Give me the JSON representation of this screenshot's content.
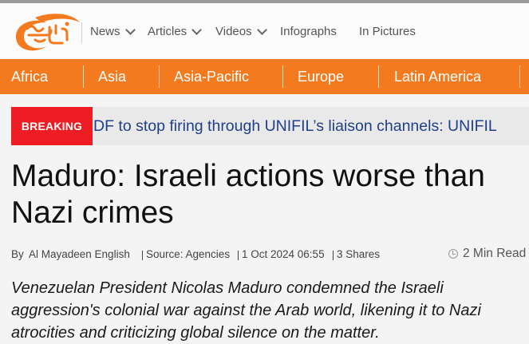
{
  "header": {
    "logo_name": "al-mayadeen-logo",
    "nav": [
      {
        "label": "News",
        "has_dropdown": true
      },
      {
        "label": "Articles",
        "has_dropdown": true
      },
      {
        "label": "Videos",
        "has_dropdown": true
      },
      {
        "label": "Infographs",
        "has_dropdown": false
      },
      {
        "label": "In Pictures",
        "has_dropdown": false
      }
    ]
  },
  "regions": [
    "Africa",
    "Asia",
    "Asia-Pacific",
    "Europe",
    "Latin America"
  ],
  "breaking": {
    "tag": "BREAKING",
    "text": "DF to stop firing through UNIFIL’s liaison channels: UNIFIL"
  },
  "article": {
    "title": "Maduro: Israeli actions worse than Nazi crimes",
    "by_label": "By",
    "author": "Al Mayadeen English",
    "source": "Source: Agencies",
    "date": "1 Oct 2024 06:55",
    "shares": "3 Shares",
    "read_time": "2 Min Read",
    "summary": "Venezuelan President Nicolas Maduro condemned the Israeli aggression's colonial war against the Arab world, likening it to Nazi atrocities and criticizing global silence on the matter."
  },
  "colors": {
    "accent": "#f47a1f",
    "breaking": "#ee1d23",
    "ticker_text": "#1f3f8a"
  }
}
